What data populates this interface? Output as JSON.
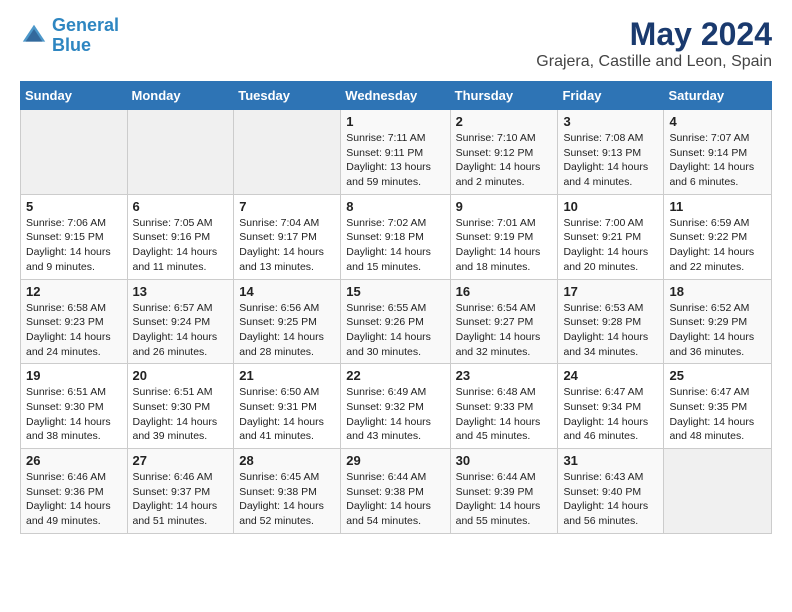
{
  "header": {
    "logo_line1": "General",
    "logo_line2": "Blue",
    "main_title": "May 2024",
    "subtitle": "Grajera, Castille and Leon, Spain"
  },
  "weekdays": [
    "Sunday",
    "Monday",
    "Tuesday",
    "Wednesday",
    "Thursday",
    "Friday",
    "Saturday"
  ],
  "weeks": [
    [
      {
        "day": "",
        "info": ""
      },
      {
        "day": "",
        "info": ""
      },
      {
        "day": "",
        "info": ""
      },
      {
        "day": "1",
        "info": "Sunrise: 7:11 AM\nSunset: 9:11 PM\nDaylight: 13 hours\nand 59 minutes."
      },
      {
        "day": "2",
        "info": "Sunrise: 7:10 AM\nSunset: 9:12 PM\nDaylight: 14 hours\nand 2 minutes."
      },
      {
        "day": "3",
        "info": "Sunrise: 7:08 AM\nSunset: 9:13 PM\nDaylight: 14 hours\nand 4 minutes."
      },
      {
        "day": "4",
        "info": "Sunrise: 7:07 AM\nSunset: 9:14 PM\nDaylight: 14 hours\nand 6 minutes."
      }
    ],
    [
      {
        "day": "5",
        "info": "Sunrise: 7:06 AM\nSunset: 9:15 PM\nDaylight: 14 hours\nand 9 minutes."
      },
      {
        "day": "6",
        "info": "Sunrise: 7:05 AM\nSunset: 9:16 PM\nDaylight: 14 hours\nand 11 minutes."
      },
      {
        "day": "7",
        "info": "Sunrise: 7:04 AM\nSunset: 9:17 PM\nDaylight: 14 hours\nand 13 minutes."
      },
      {
        "day": "8",
        "info": "Sunrise: 7:02 AM\nSunset: 9:18 PM\nDaylight: 14 hours\nand 15 minutes."
      },
      {
        "day": "9",
        "info": "Sunrise: 7:01 AM\nSunset: 9:19 PM\nDaylight: 14 hours\nand 18 minutes."
      },
      {
        "day": "10",
        "info": "Sunrise: 7:00 AM\nSunset: 9:21 PM\nDaylight: 14 hours\nand 20 minutes."
      },
      {
        "day": "11",
        "info": "Sunrise: 6:59 AM\nSunset: 9:22 PM\nDaylight: 14 hours\nand 22 minutes."
      }
    ],
    [
      {
        "day": "12",
        "info": "Sunrise: 6:58 AM\nSunset: 9:23 PM\nDaylight: 14 hours\nand 24 minutes."
      },
      {
        "day": "13",
        "info": "Sunrise: 6:57 AM\nSunset: 9:24 PM\nDaylight: 14 hours\nand 26 minutes."
      },
      {
        "day": "14",
        "info": "Sunrise: 6:56 AM\nSunset: 9:25 PM\nDaylight: 14 hours\nand 28 minutes."
      },
      {
        "day": "15",
        "info": "Sunrise: 6:55 AM\nSunset: 9:26 PM\nDaylight: 14 hours\nand 30 minutes."
      },
      {
        "day": "16",
        "info": "Sunrise: 6:54 AM\nSunset: 9:27 PM\nDaylight: 14 hours\nand 32 minutes."
      },
      {
        "day": "17",
        "info": "Sunrise: 6:53 AM\nSunset: 9:28 PM\nDaylight: 14 hours\nand 34 minutes."
      },
      {
        "day": "18",
        "info": "Sunrise: 6:52 AM\nSunset: 9:29 PM\nDaylight: 14 hours\nand 36 minutes."
      }
    ],
    [
      {
        "day": "19",
        "info": "Sunrise: 6:51 AM\nSunset: 9:30 PM\nDaylight: 14 hours\nand 38 minutes."
      },
      {
        "day": "20",
        "info": "Sunrise: 6:51 AM\nSunset: 9:30 PM\nDaylight: 14 hours\nand 39 minutes."
      },
      {
        "day": "21",
        "info": "Sunrise: 6:50 AM\nSunset: 9:31 PM\nDaylight: 14 hours\nand 41 minutes."
      },
      {
        "day": "22",
        "info": "Sunrise: 6:49 AM\nSunset: 9:32 PM\nDaylight: 14 hours\nand 43 minutes."
      },
      {
        "day": "23",
        "info": "Sunrise: 6:48 AM\nSunset: 9:33 PM\nDaylight: 14 hours\nand 45 minutes."
      },
      {
        "day": "24",
        "info": "Sunrise: 6:47 AM\nSunset: 9:34 PM\nDaylight: 14 hours\nand 46 minutes."
      },
      {
        "day": "25",
        "info": "Sunrise: 6:47 AM\nSunset: 9:35 PM\nDaylight: 14 hours\nand 48 minutes."
      }
    ],
    [
      {
        "day": "26",
        "info": "Sunrise: 6:46 AM\nSunset: 9:36 PM\nDaylight: 14 hours\nand 49 minutes."
      },
      {
        "day": "27",
        "info": "Sunrise: 6:46 AM\nSunset: 9:37 PM\nDaylight: 14 hours\nand 51 minutes."
      },
      {
        "day": "28",
        "info": "Sunrise: 6:45 AM\nSunset: 9:38 PM\nDaylight: 14 hours\nand 52 minutes."
      },
      {
        "day": "29",
        "info": "Sunrise: 6:44 AM\nSunset: 9:38 PM\nDaylight: 14 hours\nand 54 minutes."
      },
      {
        "day": "30",
        "info": "Sunrise: 6:44 AM\nSunset: 9:39 PM\nDaylight: 14 hours\nand 55 minutes."
      },
      {
        "day": "31",
        "info": "Sunrise: 6:43 AM\nSunset: 9:40 PM\nDaylight: 14 hours\nand 56 minutes."
      },
      {
        "day": "",
        "info": ""
      }
    ]
  ]
}
